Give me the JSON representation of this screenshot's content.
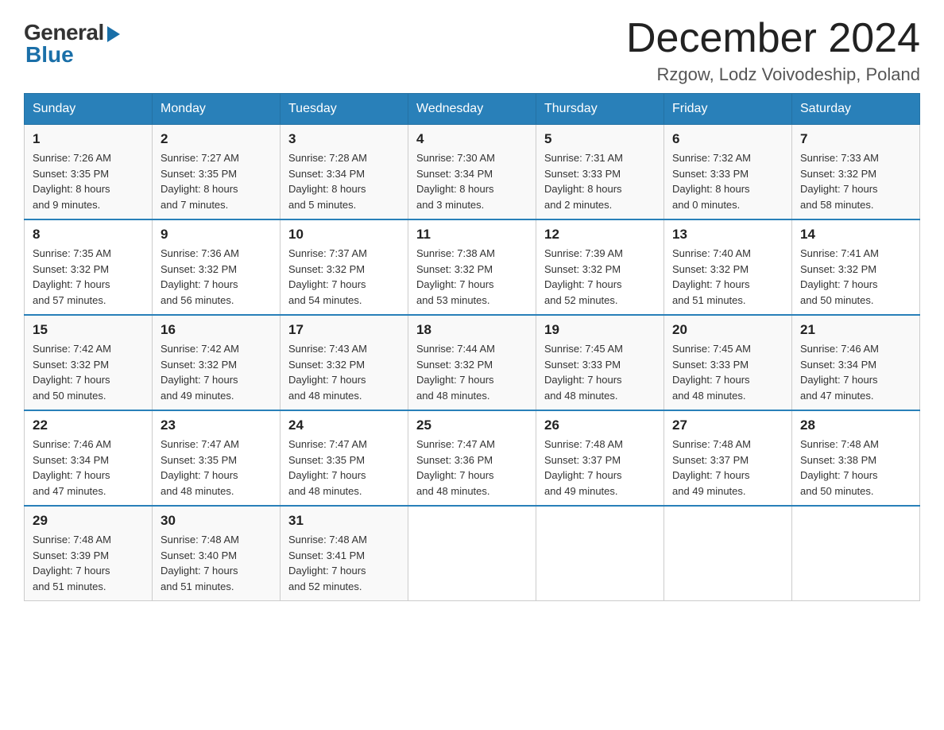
{
  "logo": {
    "general": "General",
    "blue": "Blue"
  },
  "title": "December 2024",
  "location": "Rzgow, Lodz Voivodeship, Poland",
  "days_of_week": [
    "Sunday",
    "Monday",
    "Tuesday",
    "Wednesday",
    "Thursday",
    "Friday",
    "Saturday"
  ],
  "weeks": [
    [
      {
        "day": "1",
        "sunrise": "7:26 AM",
        "sunset": "3:35 PM",
        "daylight": "8 hours and 9 minutes."
      },
      {
        "day": "2",
        "sunrise": "7:27 AM",
        "sunset": "3:35 PM",
        "daylight": "8 hours and 7 minutes."
      },
      {
        "day": "3",
        "sunrise": "7:28 AM",
        "sunset": "3:34 PM",
        "daylight": "8 hours and 5 minutes."
      },
      {
        "day": "4",
        "sunrise": "7:30 AM",
        "sunset": "3:34 PM",
        "daylight": "8 hours and 3 minutes."
      },
      {
        "day": "5",
        "sunrise": "7:31 AM",
        "sunset": "3:33 PM",
        "daylight": "8 hours and 2 minutes."
      },
      {
        "day": "6",
        "sunrise": "7:32 AM",
        "sunset": "3:33 PM",
        "daylight": "8 hours and 0 minutes."
      },
      {
        "day": "7",
        "sunrise": "7:33 AM",
        "sunset": "3:32 PM",
        "daylight": "7 hours and 58 minutes."
      }
    ],
    [
      {
        "day": "8",
        "sunrise": "7:35 AM",
        "sunset": "3:32 PM",
        "daylight": "7 hours and 57 minutes."
      },
      {
        "day": "9",
        "sunrise": "7:36 AM",
        "sunset": "3:32 PM",
        "daylight": "7 hours and 56 minutes."
      },
      {
        "day": "10",
        "sunrise": "7:37 AM",
        "sunset": "3:32 PM",
        "daylight": "7 hours and 54 minutes."
      },
      {
        "day": "11",
        "sunrise": "7:38 AM",
        "sunset": "3:32 PM",
        "daylight": "7 hours and 53 minutes."
      },
      {
        "day": "12",
        "sunrise": "7:39 AM",
        "sunset": "3:32 PM",
        "daylight": "7 hours and 52 minutes."
      },
      {
        "day": "13",
        "sunrise": "7:40 AM",
        "sunset": "3:32 PM",
        "daylight": "7 hours and 51 minutes."
      },
      {
        "day": "14",
        "sunrise": "7:41 AM",
        "sunset": "3:32 PM",
        "daylight": "7 hours and 50 minutes."
      }
    ],
    [
      {
        "day": "15",
        "sunrise": "7:42 AM",
        "sunset": "3:32 PM",
        "daylight": "7 hours and 50 minutes."
      },
      {
        "day": "16",
        "sunrise": "7:42 AM",
        "sunset": "3:32 PM",
        "daylight": "7 hours and 49 minutes."
      },
      {
        "day": "17",
        "sunrise": "7:43 AM",
        "sunset": "3:32 PM",
        "daylight": "7 hours and 48 minutes."
      },
      {
        "day": "18",
        "sunrise": "7:44 AM",
        "sunset": "3:32 PM",
        "daylight": "7 hours and 48 minutes."
      },
      {
        "day": "19",
        "sunrise": "7:45 AM",
        "sunset": "3:33 PM",
        "daylight": "7 hours and 48 minutes."
      },
      {
        "day": "20",
        "sunrise": "7:45 AM",
        "sunset": "3:33 PM",
        "daylight": "7 hours and 48 minutes."
      },
      {
        "day": "21",
        "sunrise": "7:46 AM",
        "sunset": "3:34 PM",
        "daylight": "7 hours and 47 minutes."
      }
    ],
    [
      {
        "day": "22",
        "sunrise": "7:46 AM",
        "sunset": "3:34 PM",
        "daylight": "7 hours and 47 minutes."
      },
      {
        "day": "23",
        "sunrise": "7:47 AM",
        "sunset": "3:35 PM",
        "daylight": "7 hours and 48 minutes."
      },
      {
        "day": "24",
        "sunrise": "7:47 AM",
        "sunset": "3:35 PM",
        "daylight": "7 hours and 48 minutes."
      },
      {
        "day": "25",
        "sunrise": "7:47 AM",
        "sunset": "3:36 PM",
        "daylight": "7 hours and 48 minutes."
      },
      {
        "day": "26",
        "sunrise": "7:48 AM",
        "sunset": "3:37 PM",
        "daylight": "7 hours and 49 minutes."
      },
      {
        "day": "27",
        "sunrise": "7:48 AM",
        "sunset": "3:37 PM",
        "daylight": "7 hours and 49 minutes."
      },
      {
        "day": "28",
        "sunrise": "7:48 AM",
        "sunset": "3:38 PM",
        "daylight": "7 hours and 50 minutes."
      }
    ],
    [
      {
        "day": "29",
        "sunrise": "7:48 AM",
        "sunset": "3:39 PM",
        "daylight": "7 hours and 51 minutes."
      },
      {
        "day": "30",
        "sunrise": "7:48 AM",
        "sunset": "3:40 PM",
        "daylight": "7 hours and 51 minutes."
      },
      {
        "day": "31",
        "sunrise": "7:48 AM",
        "sunset": "3:41 PM",
        "daylight": "7 hours and 52 minutes."
      },
      null,
      null,
      null,
      null
    ]
  ],
  "labels": {
    "sunrise": "Sunrise:",
    "sunset": "Sunset:",
    "daylight": "Daylight:"
  }
}
